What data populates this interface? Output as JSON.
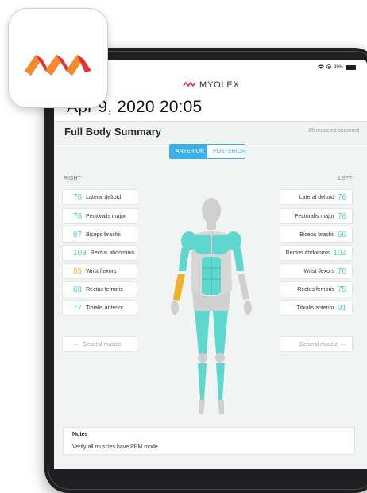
{
  "app": {
    "brand": "MYOLEX"
  },
  "status_bar": {
    "battery": "99%"
  },
  "header": {
    "date_time": "Apr 9, 2020 20:05"
  },
  "summary": {
    "title": "Full Body Summary",
    "count": "25 muscles scanned"
  },
  "view_toggle": {
    "anterior": "ANTERIOR",
    "posterior": "POSTERIOR",
    "selected": "ANTERIOR"
  },
  "sides": {
    "right": "RIGHT",
    "left": "LEFT"
  },
  "right_muscles": [
    {
      "value": "76",
      "name": "Lateral deltoid"
    },
    {
      "value": "76",
      "name": "Pectoralis major"
    },
    {
      "value": "67",
      "name": "Biceps brachii"
    },
    {
      "value": "103",
      "name": "Rectus abdominis"
    },
    {
      "value": "65",
      "name": "Wrist flexors",
      "status": "warning"
    },
    {
      "value": "69",
      "name": "Rectus femoris"
    },
    {
      "value": "77",
      "name": "Tibialis anterior"
    }
  ],
  "left_muscles": [
    {
      "value": "76",
      "name": "Lateral deltoid"
    },
    {
      "value": "76",
      "name": "Pectoralis major"
    },
    {
      "value": "66",
      "name": "Biceps brachii"
    },
    {
      "value": "102",
      "name": "Rectus abdominis"
    },
    {
      "value": "70",
      "name": "Wrist flexors"
    },
    {
      "value": "75",
      "name": "Rectus femoris"
    },
    {
      "value": "91",
      "name": "Tibialis anterior"
    }
  ],
  "general": {
    "right_value": "--",
    "right_name": "General muscle",
    "left_value": "--",
    "left_name": "General muscle"
  },
  "notes": {
    "title": "Notes",
    "text": "Verify all muscles have PPM mode."
  },
  "colors": {
    "accent": "#39b0ea",
    "muscle_value": "#4ccfcb",
    "warning": "#f0b225",
    "logo_red": "#e8303b",
    "logo_orange": "#f5892b"
  }
}
